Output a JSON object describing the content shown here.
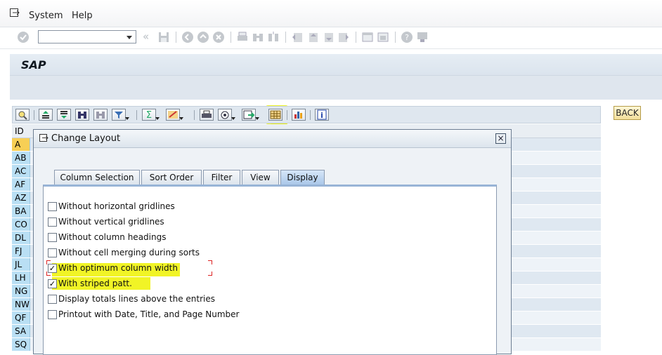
{
  "menu": {
    "items": [
      "System",
      "Help"
    ]
  },
  "title": {
    "text": "SAP"
  },
  "back_button": {
    "label": "BACK"
  },
  "grid": {
    "header_id": "ID",
    "rows": [
      "A",
      "AB",
      "AC",
      "AF",
      "AZ",
      "BA",
      "CO",
      "DL",
      "FJ",
      "JL",
      "LH",
      "NG",
      "NW",
      "QF",
      "SA",
      "SQ"
    ]
  },
  "dialog": {
    "title": "Change Layout",
    "close": "×",
    "tabs": [
      {
        "label": "Column Selection"
      },
      {
        "label": "Sort Order"
      },
      {
        "label": "Filter"
      },
      {
        "label": "View"
      },
      {
        "label": "Display",
        "active": true
      }
    ],
    "options": [
      {
        "label": "Without horizontal gridlines",
        "checked": false
      },
      {
        "label": "Without vertical gridlines",
        "checked": false
      },
      {
        "label": "Without column headings",
        "checked": false
      },
      {
        "label": "Without cell merging during sorts",
        "checked": false
      },
      {
        "label": "With optimum column width",
        "checked": true,
        "highlighted": true
      },
      {
        "label": "With striped patt.",
        "checked": true,
        "highlighted": true
      },
      {
        "label": "Display totals lines above the entries",
        "checked": false
      },
      {
        "label": "Printout with Date, Title, and Page Number",
        "checked": false
      }
    ]
  },
  "colors": {
    "highlight": "#eef200",
    "key_column": "#b9dff4",
    "active_key": "#f7cf55"
  }
}
